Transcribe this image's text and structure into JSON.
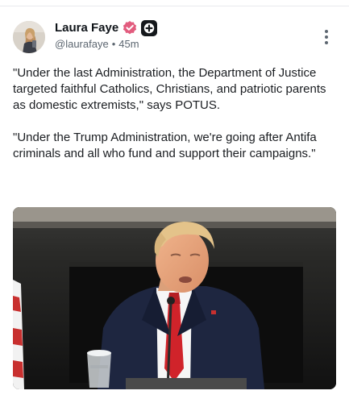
{
  "author": {
    "name": "Laura Faye",
    "handle": "@laurafaye",
    "separator": "•",
    "time": "45m",
    "verified": true,
    "subscriber_badge": true
  },
  "post": {
    "paragraphs": [
      "\"Under the last Administration, the Department of Justice targeted faithful Catholics, Christians, and patriotic parents as domestic extremists,\" says POTUS.",
      "\"Under the Trump Administration, we're going after Antifa criminals and all who fund and support their campaigns.\""
    ]
  },
  "icons": {
    "avatar": "avatar",
    "verified": "verified-check-icon",
    "subscriber": "plus-badge-icon",
    "more": "more-vertical-icon"
  },
  "colors": {
    "verified_badge": "#e25c7e",
    "plus_badge": "#15181c",
    "handle_text": "#5c6670",
    "divider": "#e8eaed"
  }
}
